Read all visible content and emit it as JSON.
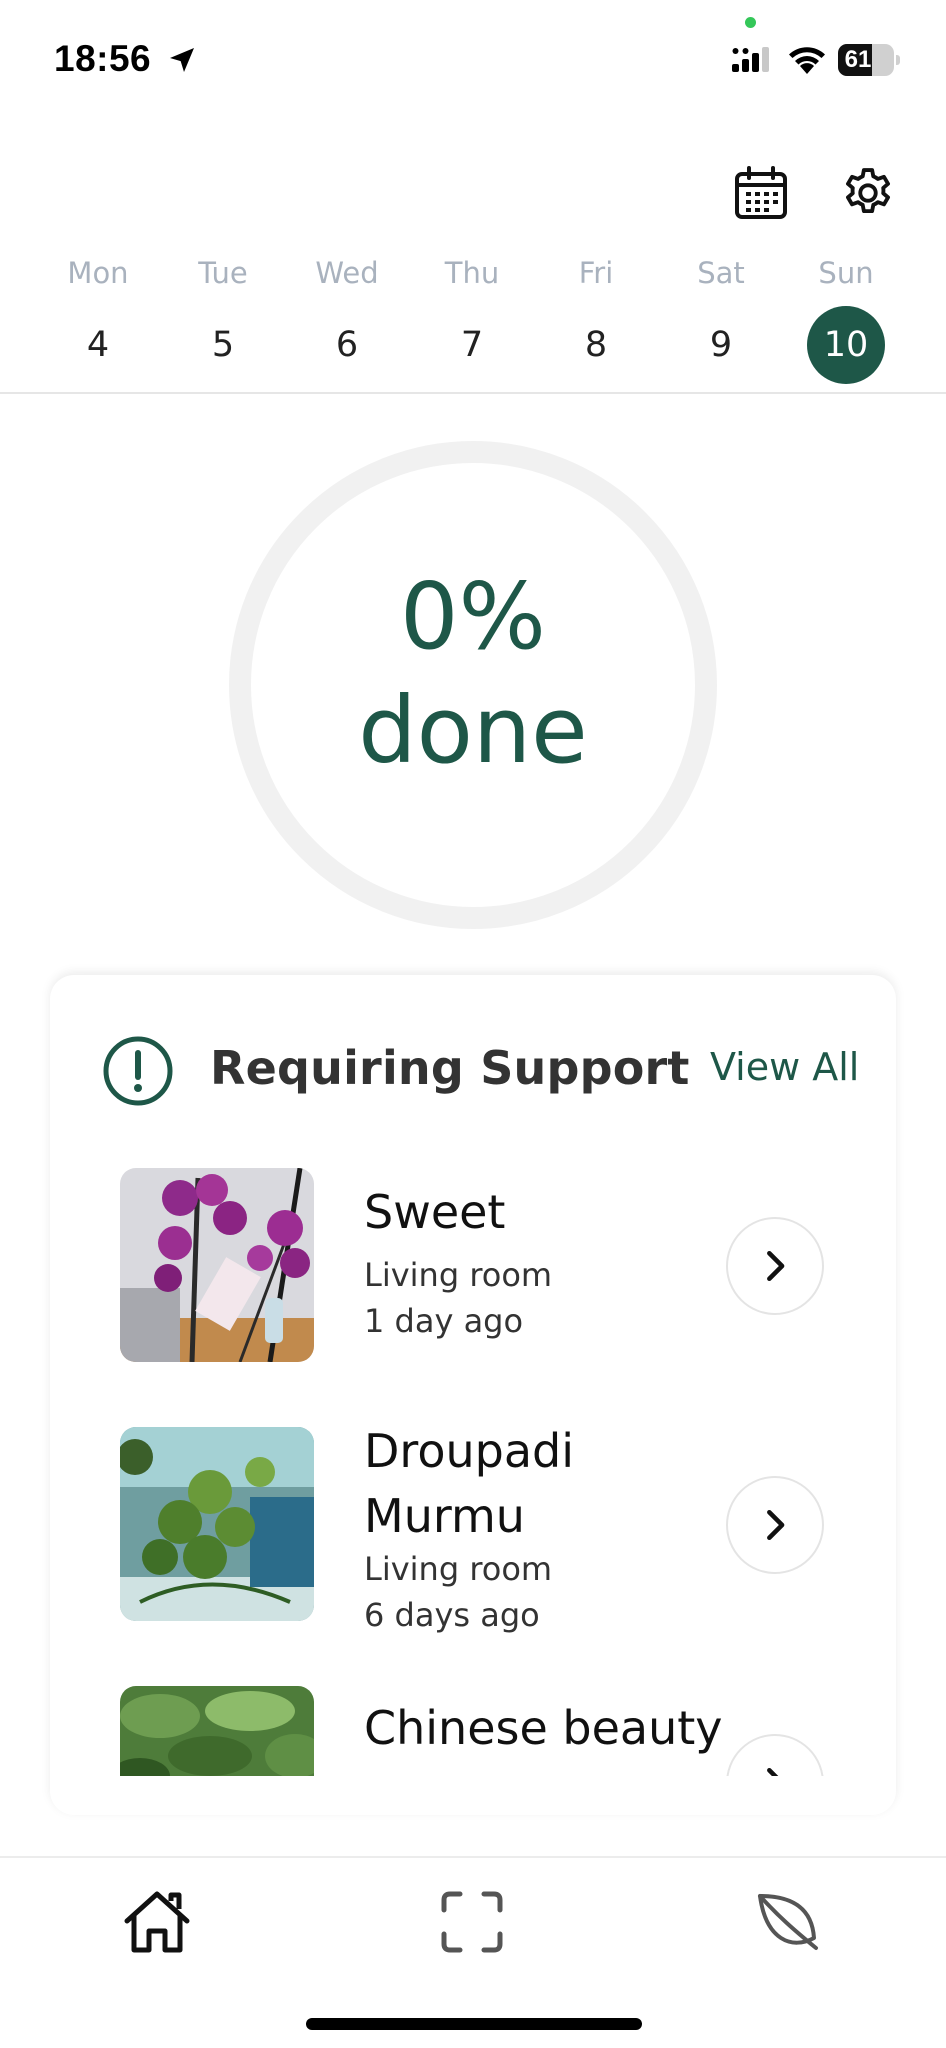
{
  "status_bar": {
    "time": "18:56",
    "battery_level": "61",
    "battery_fraction": 0.61
  },
  "header": {
    "calendar_icon": "calendar-icon",
    "settings_icon": "gear-icon"
  },
  "week": {
    "days": [
      {
        "name": "Mon",
        "number": "4"
      },
      {
        "name": "Tue",
        "number": "5"
      },
      {
        "name": "Wed",
        "number": "6"
      },
      {
        "name": "Thu",
        "number": "7"
      },
      {
        "name": "Fri",
        "number": "8"
      },
      {
        "name": "Sat",
        "number": "9"
      },
      {
        "name": "Sun",
        "number": "10"
      }
    ],
    "selected_index": 6
  },
  "progress": {
    "percent_label": "0%",
    "done_label": "done",
    "value": 0
  },
  "support": {
    "title": "Requiring Support",
    "view_all": "View All",
    "plants": [
      {
        "name": "Sweet",
        "room": "Living room",
        "last_seen": "1 day ago"
      },
      {
        "name": "Droupadi Murmu",
        "name_line1": "Droupadi",
        "name_line2": "Murmu",
        "room": "Living room",
        "last_seen": "6 days ago"
      },
      {
        "name": "Chinese beauty"
      }
    ]
  },
  "tabbar": {
    "items": [
      "home-icon",
      "scan-icon",
      "leaf-icon"
    ]
  },
  "colors": {
    "accent": "#1e5748",
    "day_label": "#a9b2be",
    "ring_track": "#f1f1f1"
  }
}
